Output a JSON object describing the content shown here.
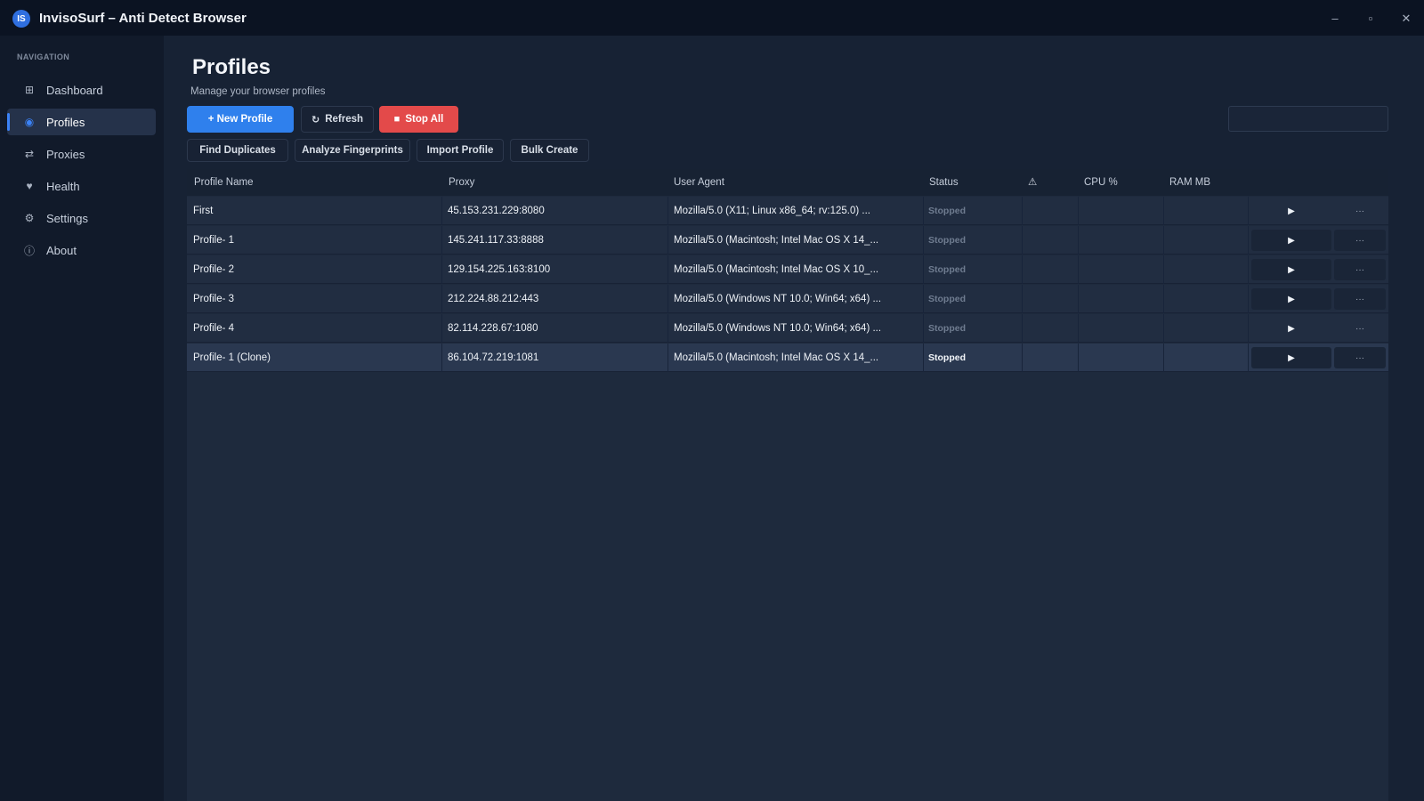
{
  "window": {
    "logo_text": "IS",
    "title": "InvisoSurf – Anti Detect Browser",
    "controls": {
      "minimize": "–",
      "maximize": "▫",
      "close": "✕"
    }
  },
  "sidebar": {
    "heading": "NAVIGATION",
    "items": [
      {
        "label": "Dashboard",
        "icon": "dashboard-icon",
        "glyph": "⊞",
        "active": false
      },
      {
        "label": "Profiles",
        "icon": "profiles-icon",
        "glyph": "◉",
        "active": true
      },
      {
        "label": "Proxies",
        "icon": "proxies-icon",
        "glyph": "⇄",
        "active": false
      },
      {
        "label": "Health",
        "icon": "heart-icon",
        "glyph": "♥",
        "active": false
      },
      {
        "label": "Settings",
        "icon": "gear-icon",
        "glyph": "⚙",
        "active": false
      },
      {
        "label": "About",
        "icon": "info-icon",
        "glyph": "ⓘ",
        "active": false
      }
    ]
  },
  "header": {
    "title": "Profiles",
    "subtitle": "Manage your browser profiles"
  },
  "toolbar": {
    "new_profile": "+ New Profile",
    "refresh_icon": "↻",
    "refresh": "Refresh",
    "stop_icon": "■",
    "stop_all": "Stop All",
    "search_value": "",
    "search_placeholder": ""
  },
  "secondary_toolbar": {
    "find_duplicates": "Find Duplicates",
    "analyze_fingerprints": "Analyze Fingerprints",
    "import_profile": "Import Profile",
    "bulk_create": "Bulk Create"
  },
  "table": {
    "columns": {
      "name": "Profile Name",
      "proxy": "Proxy",
      "user_agent": "User Agent",
      "status": "Status",
      "warning_icon": "⚠",
      "cpu": "CPU %",
      "ram": "RAM MB"
    },
    "rows": [
      {
        "name": "First",
        "proxy": "45.153.231.229:8080",
        "user_agent": "Mozilla/5.0 (X11; Linux x86_64; rv:125.0) ...",
        "status": "Stopped",
        "cpu": "",
        "ram": "",
        "play": "▶",
        "more": "···",
        "selected": false
      },
      {
        "name": "Profile- 1",
        "proxy": "145.241.117.33:8888",
        "user_agent": "Mozilla/5.0 (Macintosh; Intel Mac OS X 14_...",
        "status": "Stopped",
        "cpu": "",
        "ram": "",
        "play": "▶",
        "more": "···",
        "selected": false
      },
      {
        "name": "Profile- 2",
        "proxy": "129.154.225.163:8100",
        "user_agent": "Mozilla/5.0 (Macintosh; Intel Mac OS X 10_...",
        "status": "Stopped",
        "cpu": "",
        "ram": "",
        "play": "▶",
        "more": "···",
        "selected": false
      },
      {
        "name": "Profile- 3",
        "proxy": "212.224.88.212:443",
        "user_agent": "Mozilla/5.0 (Windows NT 10.0; Win64; x64) ...",
        "status": "Stopped",
        "cpu": "",
        "ram": "",
        "play": "▶",
        "more": "···",
        "selected": false
      },
      {
        "name": "Profile- 4",
        "proxy": "82.114.228.67:1080",
        "user_agent": "Mozilla/5.0 (Windows NT 10.0; Win64; x64) ...",
        "status": "Stopped",
        "cpu": "",
        "ram": "",
        "play": "▶",
        "more": "···",
        "selected": false
      },
      {
        "name": "Profile- 1 (Clone)",
        "proxy": "86.104.72.219:1081",
        "user_agent": "Mozilla/5.0 (Macintosh; Intel Mac OS X 14_...",
        "status": "Stopped",
        "cpu": "",
        "ram": "",
        "play": "▶",
        "more": "···",
        "selected": true
      }
    ]
  },
  "colors": {
    "accent": "#2f80ed",
    "danger": "#e34a4a",
    "background": "#172234",
    "sidebar": "#111a2a"
  }
}
